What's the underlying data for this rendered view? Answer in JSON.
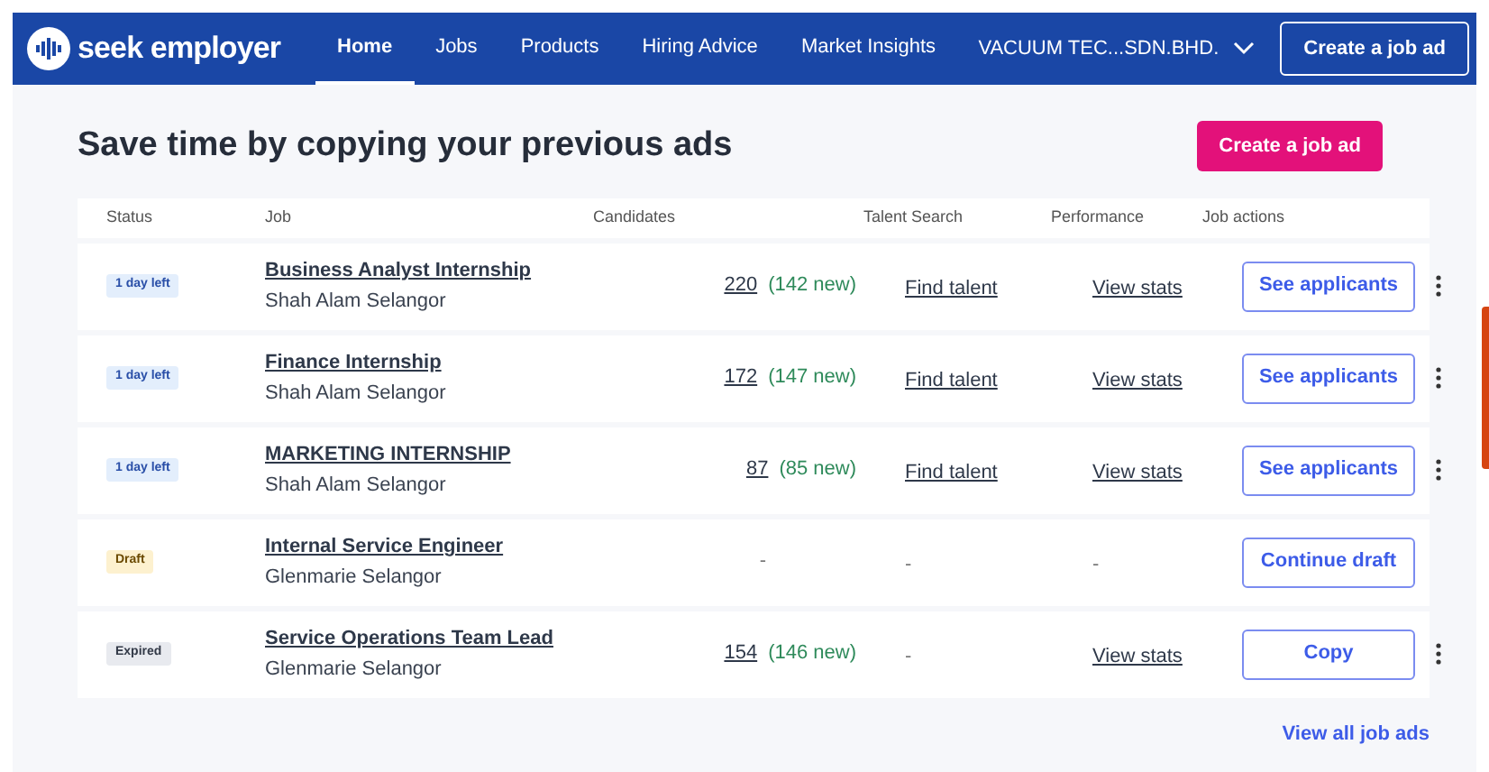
{
  "header": {
    "logo": "seek employer",
    "nav": [
      {
        "label": "Home",
        "selected": true
      },
      {
        "label": "Jobs",
        "selected": false
      },
      {
        "label": "Products",
        "selected": false
      },
      {
        "label": "Hiring Advice",
        "selected": false
      },
      {
        "label": "Market Insights",
        "selected": false
      }
    ],
    "account": "VACUUM TEC...SDN.BHD.",
    "cta": "Create a job ad"
  },
  "page": {
    "title": "Save time by copying your previous ads",
    "cta": "Create a job ad"
  },
  "table": {
    "columns": [
      "Status",
      "Job",
      "Candidates",
      "Talent Search",
      "Performance",
      "Job actions"
    ],
    "rows": [
      {
        "status": {
          "kind": "active",
          "label": "1 day left"
        },
        "job": "Business Analyst Internship",
        "location": "Shah Alam Selangor",
        "candidates": "220",
        "new": "(142 new)",
        "talent": "Find talent",
        "performance": "View stats",
        "action": "See applicants",
        "menu": true
      },
      {
        "status": {
          "kind": "active",
          "label": "1 day left"
        },
        "job": "Finance Internship",
        "location": "Shah Alam Selangor",
        "candidates": "172",
        "new": "(147 new)",
        "talent": "Find talent",
        "performance": "View stats",
        "action": "See applicants",
        "menu": true
      },
      {
        "status": {
          "kind": "active",
          "label": "1 day left"
        },
        "job": "MARKETING INTERNSHIP",
        "location": "Shah Alam Selangor",
        "candidates": "87",
        "new": "(85 new)",
        "talent": "Find talent",
        "performance": "View stats",
        "action": "See applicants",
        "menu": true
      },
      {
        "status": {
          "kind": "draft",
          "label": "Draft"
        },
        "job": "Internal Service Engineer",
        "location": "Glenmarie Selangor",
        "candidates": "-",
        "talent": "-",
        "performance": "-",
        "action": "Continue draft",
        "menu": false
      },
      {
        "status": {
          "kind": "expired",
          "label": "Expired"
        },
        "job": "Service Operations Team Lead",
        "location": "Glenmarie Selangor",
        "candidates": "154",
        "new": "(146 new)",
        "talent": "-",
        "performance": "View stats",
        "action": "Copy",
        "menu": true
      }
    ]
  },
  "footer_link": "View all job ads"
}
